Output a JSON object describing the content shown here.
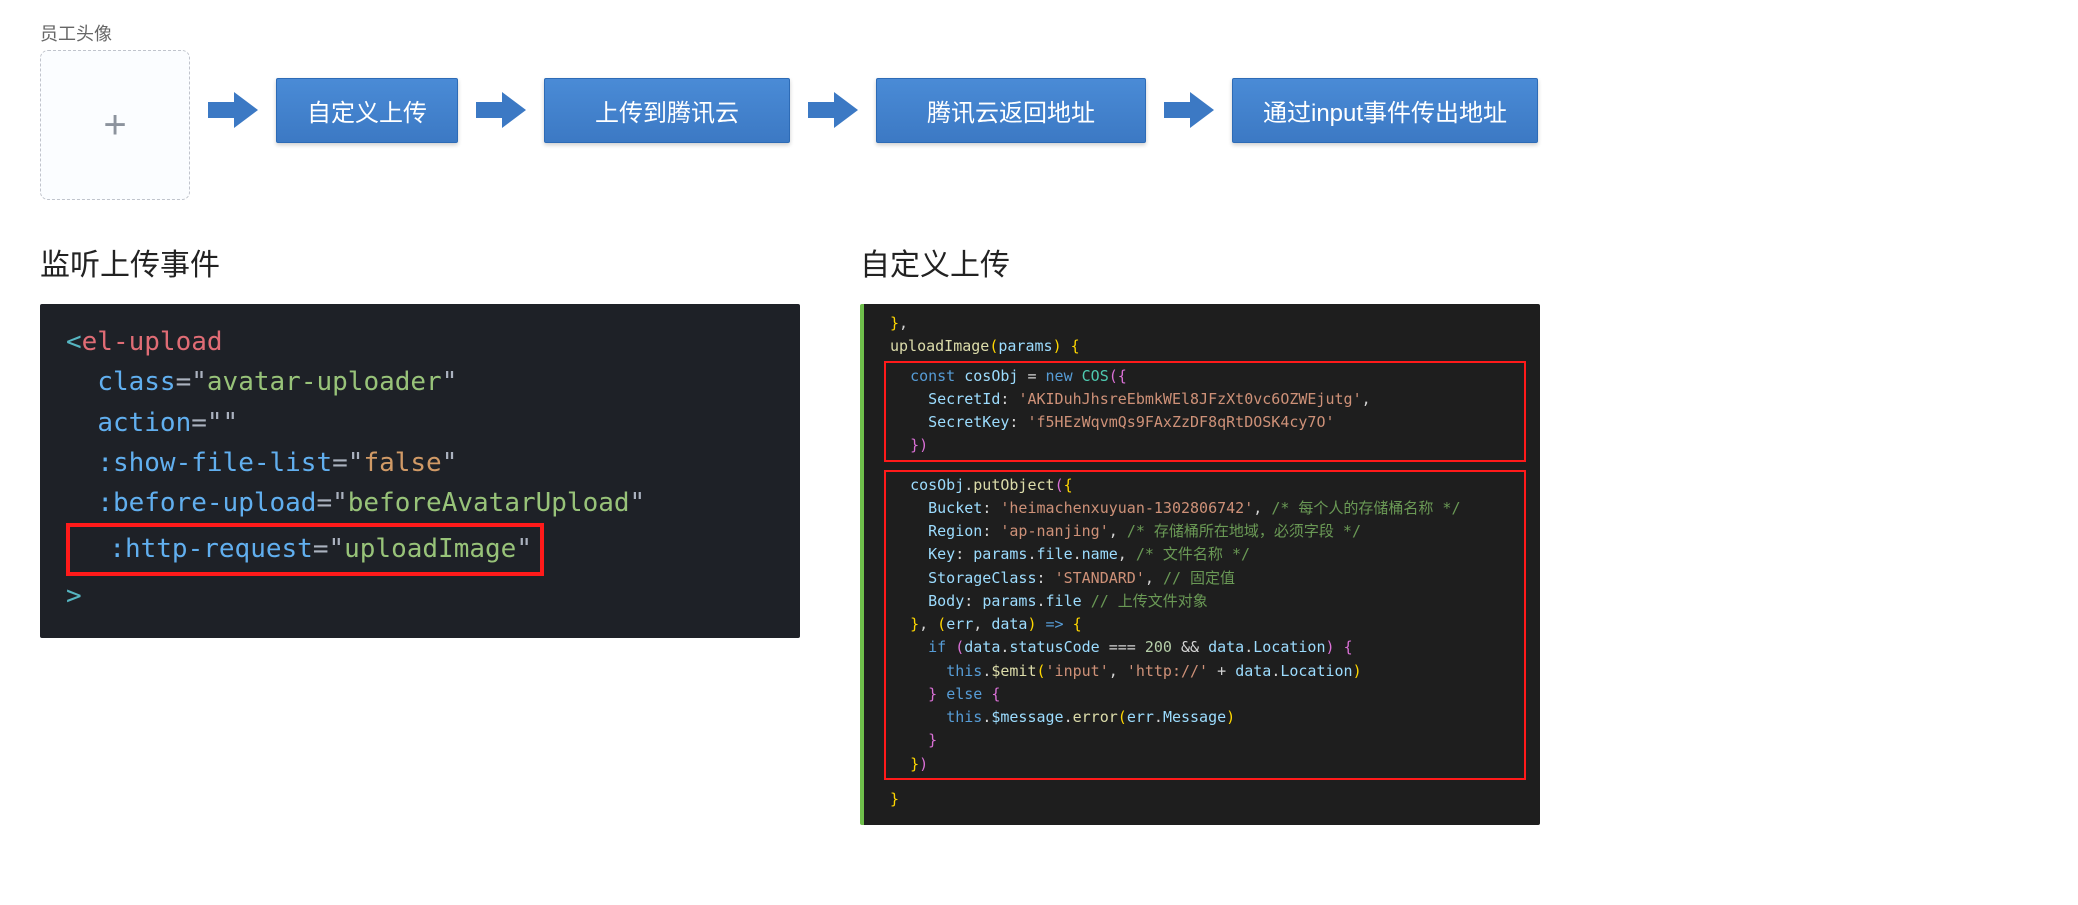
{
  "uploadLabel": "员工头像",
  "plusGlyph": "+",
  "flow": {
    "step1": "自定义上传",
    "step2": "上传到腾讯云",
    "step3": "腾讯云返回地址",
    "step4": "通过input事件传出地址"
  },
  "leftSection": {
    "title": "监听上传事件",
    "code": {
      "tag": "el-upload",
      "classAttr": "class",
      "classVal": "avatar-uploader",
      "actionAttr": "action",
      "actionVal": "",
      "showFileListAttr": ":show-file-list",
      "showFileListVal": "false",
      "beforeUploadAttr": ":before-upload",
      "beforeUploadVal": "beforeAvatarUpload",
      "httpRequestAttr": ":http-request",
      "httpRequestVal": "uploadImage"
    }
  },
  "rightSection": {
    "title": "自定义上传",
    "code": {
      "fnName": "uploadImage",
      "fnArg": "params",
      "constKw": "const",
      "cosVar": "cosObj",
      "newKw": "new",
      "cosType": "COS",
      "secretIdKey": "SecretId",
      "secretIdVal": "'AKIDuhJhsreEbmkWEl8JFzXt0vc6OZWEjutg'",
      "secretKeyKey": "SecretKey",
      "secretKeyVal": "'f5HEzWqvmQs9FAxZzDF8qRtDOSK4cy7O'",
      "putObject": "putObject",
      "bucketKey": "Bucket",
      "bucketVal": "'heimachenxuyuan-1302806742'",
      "bucketCm": "/* 每个人的存储桶名称 */",
      "regionKey": "Region",
      "regionVal": "'ap-nanjing'",
      "regionCm": "/* 存储桶所在地域，必须字段 */",
      "keyKey": "Key",
      "keyValPrefix": "params",
      "keyValFile": "file",
      "keyValName": "name",
      "keyCm": "/* 文件名称 */",
      "storageKey": "StorageClass",
      "storageVal": "'STANDARD'",
      "storageCm": "// 固定值",
      "bodyKey": "Body",
      "bodyCm": "// 上传文件对象",
      "cbErr": "err",
      "cbData": "data",
      "ifKw": "if",
      "statusCode": "statusCode",
      "eq200": "200",
      "location": "Location",
      "thisKw": "this",
      "emit": "$emit",
      "inputStr": "'input'",
      "httpStr": "'http://'",
      "elseKw": "else",
      "message": "$message",
      "error": "error",
      "errMsg": "Message"
    }
  }
}
